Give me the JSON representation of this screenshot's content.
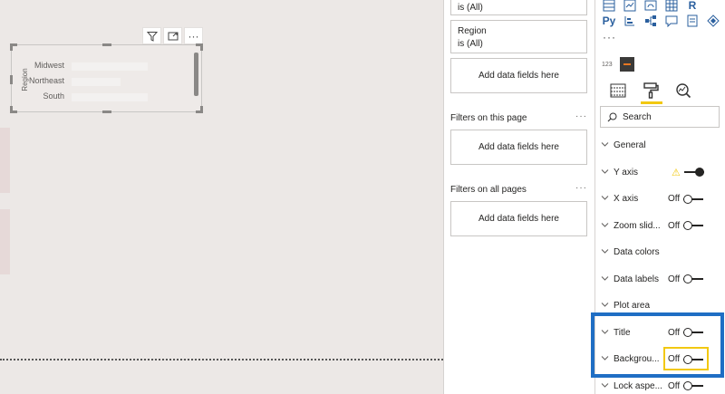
{
  "visual": {
    "axis_title": "Region",
    "categories": [
      "Midwest",
      "Northeast",
      "South"
    ],
    "bar_fractions": [
      0.98,
      0.63,
      0.98
    ],
    "toolbar_icons": [
      "filter-icon",
      "focus-mode-icon",
      "more-options-icon"
    ],
    "more_label": "···"
  },
  "filters": {
    "top_card_line": "is (All)",
    "region_card": {
      "field": "Region",
      "value": "is (All)"
    },
    "add_fields_label": "Add data fields here",
    "this_page_label": "Filters on this page",
    "all_pages_label": "Filters on all pages",
    "dots": "···"
  },
  "viz_pane": {
    "row1_icons": [
      "table-icon",
      "kpi-icon",
      "gauge-icon",
      "matrix-icon",
      "r-visual-icon"
    ],
    "row1_r_label": "R",
    "row2_py_label": "Py",
    "row2_icons": [
      "python-visual-icon",
      "key-influencers-icon",
      "decomposition-tree-icon",
      "qa-icon",
      "paginated-report-icon",
      "power-apps-icon"
    ],
    "more_dots": "···",
    "tiny_label": "123",
    "tabs": [
      "fields-tab",
      "format-tab",
      "analytics-tab"
    ],
    "search_label": "Search",
    "properties": [
      {
        "name": "General",
        "state": "",
        "toggle": "none"
      },
      {
        "name": "Y axis",
        "state": "",
        "toggle": "on",
        "warning": "⚠"
      },
      {
        "name": "X axis",
        "state": "Off",
        "toggle": "off"
      },
      {
        "name": "Zoom slid...",
        "state": "Off",
        "toggle": "off"
      },
      {
        "name": "Data colors",
        "state": "",
        "toggle": "none"
      },
      {
        "name": "Data labels",
        "state": "Off",
        "toggle": "off"
      },
      {
        "name": "Plot area",
        "state": "",
        "toggle": "none"
      },
      {
        "name": "Title",
        "state": "Off",
        "toggle": "off"
      },
      {
        "name": "Backgrou...",
        "state": "Off",
        "toggle": "off"
      },
      {
        "name": "Lock aspe...",
        "state": "Off",
        "toggle": "off"
      }
    ],
    "highlight_color": "#1f6ec4",
    "accent_color": "#f2c811"
  }
}
